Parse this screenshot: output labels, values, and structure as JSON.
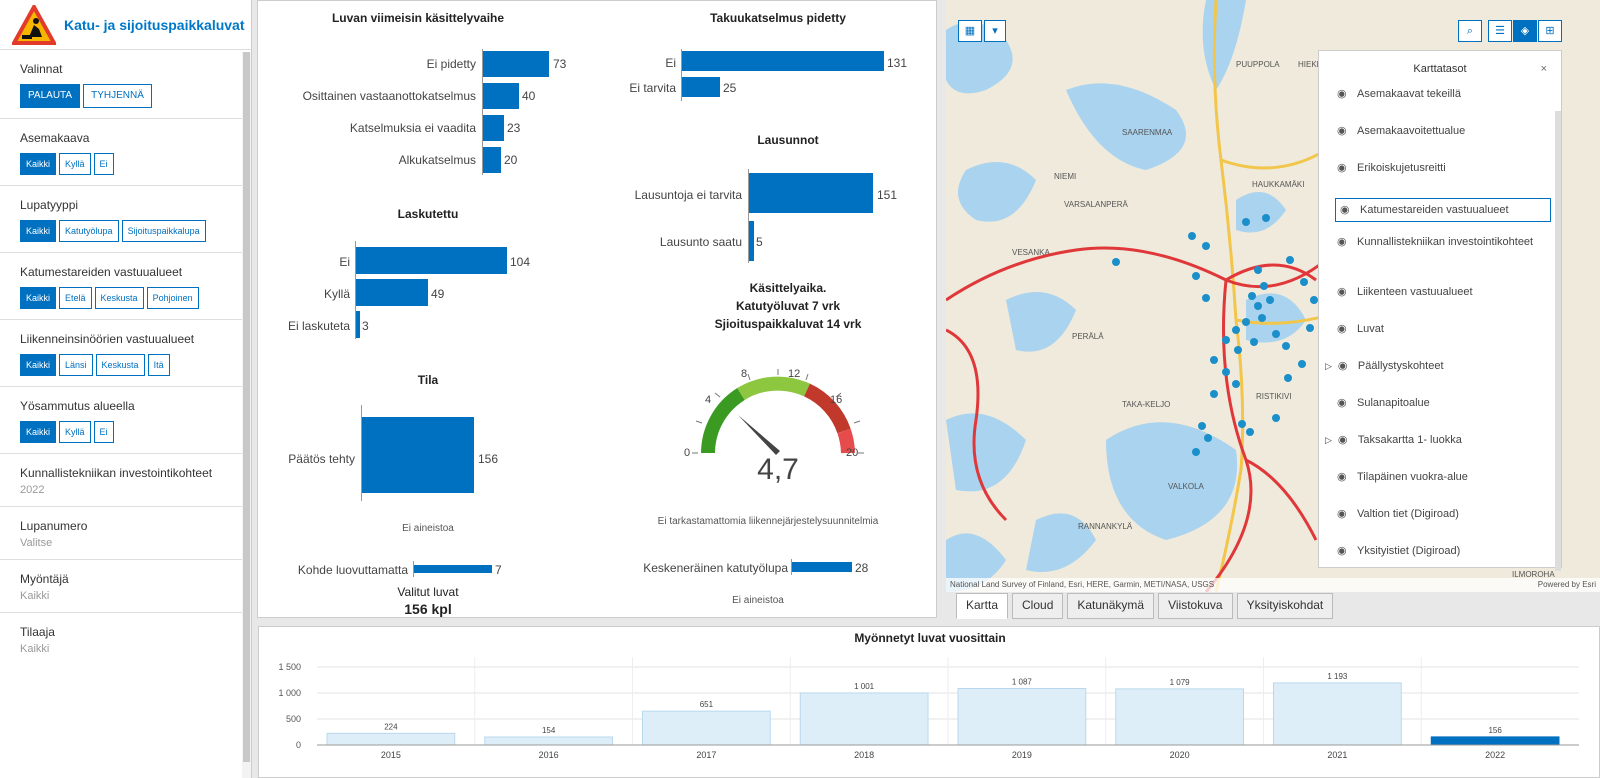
{
  "app": {
    "title": "Katu- ja sijoituspaikkaluvat"
  },
  "sidebar": {
    "valinnat": {
      "title": "Valinnat",
      "buttons": [
        "PALAUTA",
        "TYHJENNÄ"
      ]
    },
    "asemakaava": {
      "title": "Asemakaava",
      "options": [
        "Kaikki",
        "Kyllä",
        "Ei"
      ],
      "selected": "Kaikki"
    },
    "lupatyyppi": {
      "title": "Lupatyyppi",
      "options": [
        "Kaikki",
        "Katutyölupa",
        "Sijoituspaikkalupa"
      ],
      "selected": "Kaikki"
    },
    "katumestari": {
      "title": "Katumestareiden vastuualueet",
      "options": [
        "Kaikki",
        "Etelä",
        "Keskusta",
        "Pohjoinen"
      ],
      "selected": "Kaikki"
    },
    "liikenne": {
      "title": "Liikenneinsinöörien vastuualueet",
      "options": [
        "Kaikki",
        "Länsi",
        "Keskusta",
        "Itä"
      ],
      "selected": "Kaikki"
    },
    "yosammutus": {
      "title": "Yösammutus alueella",
      "options": [
        "Kaikki",
        "Kyllä",
        "Ei"
      ],
      "selected": "Kaikki"
    },
    "kunnallistekniikka": {
      "title": "Kunnallistekniikan investointikohteet",
      "value": "2022"
    },
    "lupanumero": {
      "title": "Lupanumero",
      "value": "Valitse"
    },
    "myontaja": {
      "title": "Myöntäjä",
      "value": "Kaikki"
    },
    "tilaaja": {
      "title": "Tilaaja",
      "value": "Kaikki"
    }
  },
  "charts": {
    "kasittelyvaihe": {
      "title": "Luvan viimeisin käsittelyvaihe",
      "categories": [
        "Ei pidetty",
        "Osittainen vastaanottokatselmus",
        "Katselmuksia ei vaadita",
        "Alkukatselmus"
      ],
      "values": [
        73,
        40,
        23,
        20
      ]
    },
    "takuukatselmus": {
      "title": "Takuukatselmus pidetty",
      "categories": [
        "Ei",
        "Ei tarvita"
      ],
      "values": [
        131,
        25
      ]
    },
    "laskutettu": {
      "title": "Laskutettu",
      "categories": [
        "Ei",
        "Kyllä",
        "Ei laskuteta"
      ],
      "values": [
        104,
        49,
        3
      ]
    },
    "lausunnot": {
      "title": "Lausunnot",
      "categories": [
        "Lausuntoja ei tarvita",
        "Lausunto saatu"
      ],
      "values": [
        151,
        5
      ]
    },
    "tila": {
      "title": "Tila",
      "categories": [
        "Päätös tehty"
      ],
      "values": [
        156
      ],
      "note": "Ei aineistoa"
    },
    "kasittelyaika": {
      "title_lines": [
        "Käsittelyaika.",
        "Katutyöluvat  7 vrk",
        "Sjioituspaikkaluvat  14 vrk"
      ],
      "gauge_value": "4,7",
      "ticks": [
        "0",
        "4",
        "8",
        "12",
        "16",
        "20"
      ],
      "note": "Ei tarkastamattomia liikennejärjestelysuunnitelmia"
    },
    "kohde": {
      "categories": [
        "Kohde luovuttamatta"
      ],
      "values": [
        7
      ]
    },
    "keskenerainen": {
      "categories": [
        "Keskeneräinen katutyölupa"
      ],
      "values": [
        28
      ],
      "note": "Ei aineistoa"
    },
    "valitut": {
      "label": "Valitut luvat",
      "value": "156 kpl"
    }
  },
  "map": {
    "attribution": "National Land Survey of Finland, Esri, HERE, Garmin, METI/NASA, USGS",
    "powered": "Powered by Esri",
    "places": [
      "PUUPPOLA",
      "HIEKKAPOHJA",
      "SAARENMAA",
      "NIEMI",
      "HAUKKAMÄKI",
      "VARSALANPERÄ",
      "VESANKA",
      "PERÄLÄ",
      "TAKA-KELJO",
      "RISTIKIVI",
      "VALKOLA",
      "RANNANKYLÄ",
      "ILMOROHA"
    ],
    "layers_title": "Karttatasot",
    "layers": [
      "Asemakaavat tekeillä",
      "Asemakaavoitettualue",
      "Erikoiskujetusreitti",
      "Katumestareiden vastuualueet",
      "Kunnallistekniikan investointikohteet",
      "Liikenteen vastuualueet",
      "Luvat",
      "Päällystyskohteet",
      "Sulanapitoalue",
      "Taksakartta 1- luokka",
      "Tilapäinen vuokra-alue",
      "Valtion tiet (Digiroad)",
      "Yksityistiet (Digiroad)"
    ],
    "selected_layer": "Katumestareiden vastuualueet",
    "tabs": [
      "Kartta",
      "Cloud",
      "Katunäkymä",
      "Viistokuva",
      "Yksityiskohdat"
    ],
    "active_tab": "Kartta",
    "colors": {
      "dot": "#1a8fc9",
      "boundary": "#e0383a",
      "water": "#a9d3ee",
      "road": "#f2c64b"
    }
  },
  "chart_data": {
    "type": "bar",
    "title": "Myönnetyt luvat vuosittain",
    "categories": [
      "2015",
      "2016",
      "2017",
      "2018",
      "2019",
      "2020",
      "2021",
      "2022"
    ],
    "values": [
      224,
      154,
      651,
      1001,
      1087,
      1079,
      1193,
      156
    ],
    "value_labels": [
      "224",
      "154",
      "651",
      "1 001",
      "1 087",
      "1 079",
      "1 193",
      "156"
    ],
    "ylim": [
      0,
      1500
    ],
    "yticks": [
      "0",
      "500",
      "1 000",
      "1 500"
    ],
    "highlighted": "2022"
  }
}
